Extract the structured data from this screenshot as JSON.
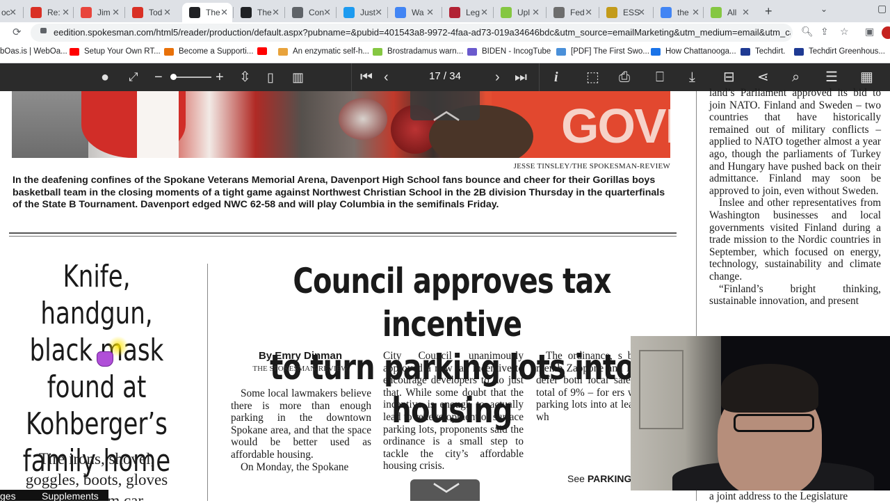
{
  "browser": {
    "tabs": [
      {
        "label": "oc",
        "favicon": "doc-icon",
        "color": "#5f6368"
      },
      {
        "label": "Re:",
        "favicon": "gmail-icon",
        "color": "#d93025"
      },
      {
        "label": "Jim",
        "favicon": "pinwheel-icon",
        "color": "#e8453c"
      },
      {
        "label": "Tod",
        "favicon": "gmail-icon",
        "color": "#d93025"
      },
      {
        "label": "The",
        "favicon": "spokesman-icon",
        "color": "#202124",
        "active": true
      },
      {
        "label": "The",
        "favicon": "spokesman-icon",
        "color": "#202124"
      },
      {
        "label": "Con",
        "favicon": "globe-icon",
        "color": "#5f6368"
      },
      {
        "label": "Just",
        "favicon": "twitter-icon",
        "color": "#1d9bf0"
      },
      {
        "label": "Wa",
        "favicon": "google-icon",
        "color": "#4285f4"
      },
      {
        "label": "Leg",
        "favicon": "flag-icon",
        "color": "#b22234"
      },
      {
        "label": "Upl",
        "favicon": "rumble-icon",
        "color": "#85c742"
      },
      {
        "label": "Fed",
        "favicon": "fed-icon",
        "color": "#6d6d6d"
      },
      {
        "label": "ESS",
        "favicon": "ess-icon",
        "color": "#c39b1a"
      },
      {
        "label": "the",
        "favicon": "google-icon",
        "color": "#4285f4"
      },
      {
        "label": "All",
        "favicon": "rumble-icon",
        "color": "#85c742"
      }
    ],
    "url": "eedition.spokesman.com/html5/reader/production/default.aspx?pubname=&pubid=401543a8-9972-4faa-ad73-019a34646bdc&utm_source=emailMarketing&utm_medium=email&utm_ca...",
    "bookmarks": [
      {
        "label": "bOas.is | WebOa...",
        "color": "#444"
      },
      {
        "label": "Setup Your Own RT...",
        "color": "#ff0000"
      },
      {
        "label": "Become a Supporti...",
        "color": "#e8710a"
      },
      {
        "label": "",
        "color": "#ff0000"
      },
      {
        "label": "An enzymatic self-h...",
        "color": "#e8a33c"
      },
      {
        "label": "Brostradamus warn...",
        "color": "#85c742"
      },
      {
        "label": "BIDEN - IncogTube",
        "color": "#6a5acd"
      },
      {
        "label": "[PDF] The First Swo...",
        "color": "#4a90d9"
      },
      {
        "label": "How Chattanooga...",
        "color": "#1a73e8"
      },
      {
        "label": "Techdirt.",
        "color": "#1f3a93"
      },
      {
        "label": "Techdirt Greenhous...",
        "color": "#1f3a93"
      }
    ]
  },
  "reader": {
    "page_counter": "17 / 34",
    "tools": [
      "user-icon",
      "fullscreen-icon",
      "zoom-out-icon",
      "zoom-slider",
      "zoom-in-icon",
      "fit-page-icon",
      "single-page-icon",
      "double-page-icon",
      "first-page-icon",
      "prev-page-icon",
      "next-page-icon",
      "last-page-icon",
      "info-icon",
      "clip-icon",
      "print-icon",
      "bookmark-icon",
      "download-icon",
      "archive-icon",
      "share-icon",
      "search-icon",
      "list-icon",
      "grid-icon"
    ]
  },
  "newspaper": {
    "photo_credit": "JESSE TINSLEY/THE SPOKESMAN-REVIEW",
    "photo_caption": "In the deafening confines of the Spokane Veterans Memorial Arena, Davenport High School fans bounce and cheer for their Gorillas boys basketball team in the closing moments of a tight game against Northwest Christian School in the 2B division Thursday in the quarterfinals of the State B Tournament. Davenport edged NWC 62-58 and will play Columbia in the semifinals Friday.",
    "photo_banner": "GOVE",
    "left_story": {
      "headline_lines": [
        "Knife, handgun,",
        "black mask",
        "found at",
        "Kohberger’s",
        "family home"
      ],
      "subhead_lines": [
        "Tire irons, shovel,",
        "goggles, boots, gloves",
        "taken from car"
      ]
    },
    "main_story": {
      "headline_lines": [
        "Council approves tax incentive",
        "to turn parking lots into housing"
      ],
      "byline": "By Emry Dinman",
      "byline_org": "THE SPOKESMAN-REVIEW",
      "col1": [
        "Some local lawmakers believe there is more than enough parking in the downtown Spokane area, and that the space would be better used as affordable housing.",
        "On Monday, the Spokane"
      ],
      "col2": [
        "City Council unanimously approved a new tax incentive to encourage developers to do just that. While some doubt that the incentive is enough to actually lead to redevelopment of surface parking lots, proponents said the ordinance is a small step to tackle the city’s affordable housing crisis."
      ],
      "col3": [
        "The ordinance, s by council memb Zappone and Lori would defer both local sales and use total of 9% – for ers who turn d parking lots into at least 50% of wh"
      ],
      "see_prefix": "See",
      "see_ref": "PARKING"
    },
    "right_column": [
      "land’s Parliament approved its bid to join NATO. Finland and Sweden – two countries that have historically remained out of military conflicts – applied to NATO together almost a year ago, though the parliaments of Turkey and Hungary have pushed back on their admittance. Finland may soon be approved to join, even without Sweden.",
      "Inslee and other representatives from Washington businesses and local governments visited Finland during a trade mission to the Nordic countries in September, which focused on energy, technology, sustainability and climate change.",
      "“Finland’s bright thinking, sustainable innovation, and present",
      "a joint address to the Legislature"
    ]
  },
  "bottom_tabs": [
    "ges",
    "Supplements"
  ]
}
